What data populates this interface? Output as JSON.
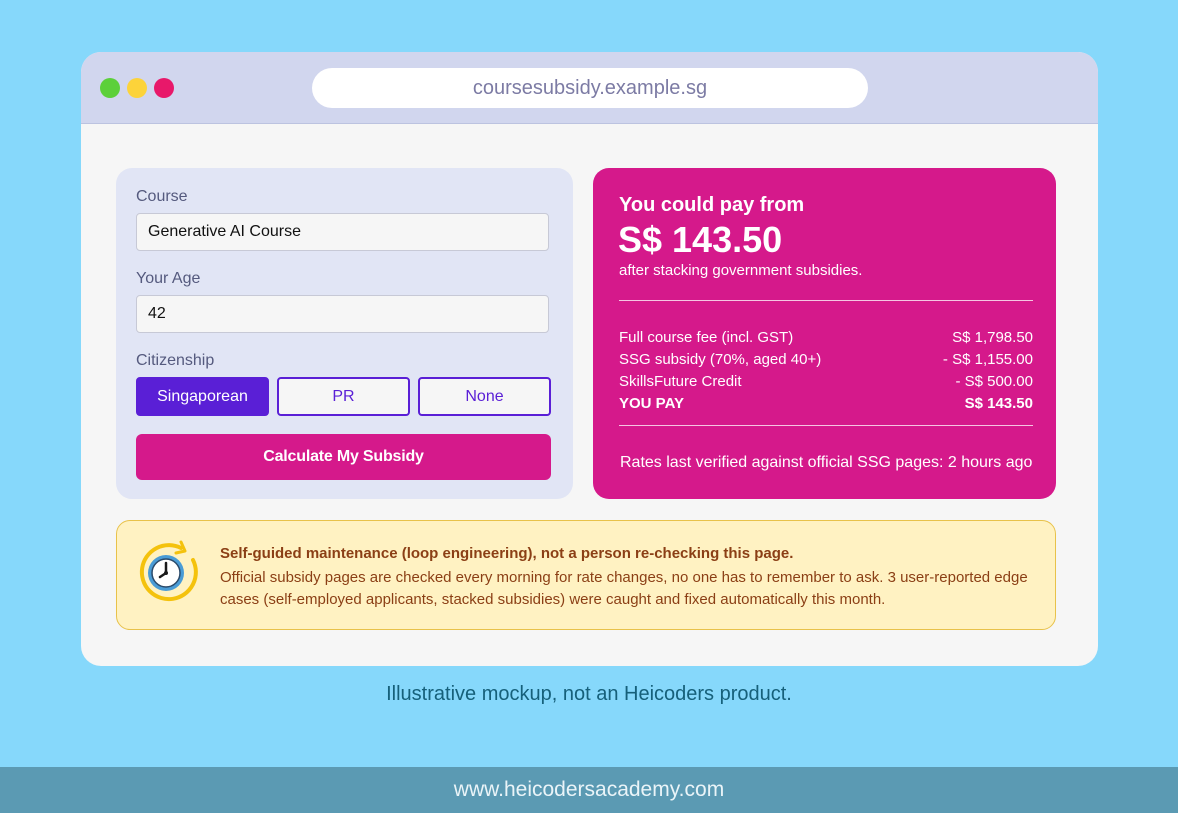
{
  "browser": {
    "url": "coursesubsidy.example.sg"
  },
  "form": {
    "course_label": "Course",
    "course_value": "Generative AI Course",
    "age_label": "Your Age",
    "age_value": "42",
    "citizenship_label": "Citizenship",
    "citizenship_options": [
      "Singaporean",
      "PR",
      "None"
    ],
    "citizenship_selected": "Singaporean",
    "calculate_label": "Calculate My Subsidy"
  },
  "result": {
    "heading": "You could pay from",
    "price": "S$ 143.50",
    "subtext": "after stacking government subsidies.",
    "rows": [
      {
        "label": "Full course fee (incl. GST)",
        "amount": "S$ 1,798.50"
      },
      {
        "label": "SSG subsidy (70%, aged 40+)",
        "amount": "- S$ 1,155.00"
      },
      {
        "label": "SkillsFuture Credit",
        "amount": "- S$ 500.00"
      },
      {
        "label": "YOU PAY",
        "amount": "S$ 143.50"
      }
    ],
    "verified": "Rates last verified against official SSG pages: 2 hours ago"
  },
  "banner": {
    "title": "Self-guided maintenance (loop engineering), not a person re-checking this page.",
    "body": "Official subsidy pages are checked every morning for rate changes, no one has to remember to ask. 3 user-reported edge cases (self-employed applicants, stacked subsidies) were caught and fixed automatically this month.",
    "icon": "clock-refresh-icon"
  },
  "disclaimer": "Illustrative mockup, not an Heicoders product.",
  "footer": "www.heicodersacademy.com",
  "colors": {
    "background": "#86d8fb",
    "accent_magenta": "#d5198b",
    "accent_purple": "#5a1fd6",
    "banner_bg": "#fff2c2"
  }
}
